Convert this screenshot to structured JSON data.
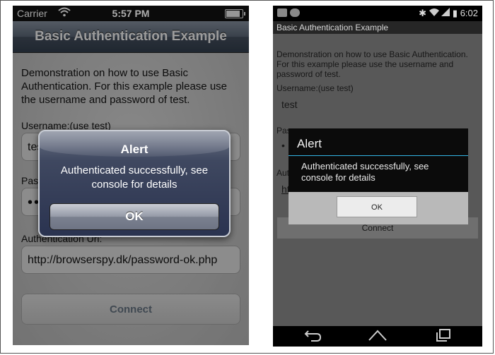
{
  "ios": {
    "status": {
      "carrier": "Carrier",
      "time": "5:57 PM"
    },
    "nav_title": "Basic Authentication Example",
    "description": "Demonstration on how to use Basic Authentication. For this example please use the username and password of test.",
    "username_label": "Username:(use test)",
    "username_value": "test",
    "password_label": "Password:(use test)",
    "password_value": "••••",
    "auth_url_label": "Authentication Url:",
    "auth_url_value": "http://browserspy.dk/password-ok.php",
    "connect_label": "Connect",
    "alert": {
      "title": "Alert",
      "message": "Authenticated successfully, see console for details",
      "ok_label": "OK"
    }
  },
  "android": {
    "status": {
      "time": "6:02"
    },
    "title": "Basic Authentication Example",
    "description": "Demonstration on how to use Basic Authentication. For this example please use the username and password of test.",
    "username_label": "Username:(use test)",
    "username_value": "test",
    "password_label_fragment": "Pass",
    "password_dots": "•",
    "auth_label_fragment": "Auth",
    "url_fragment": "ht",
    "connect_label": "Connect",
    "alert": {
      "title": "Alert",
      "message": "Authenticated successfully, see console for details",
      "ok_label": "OK"
    },
    "accent_color": "#33b5e5"
  }
}
